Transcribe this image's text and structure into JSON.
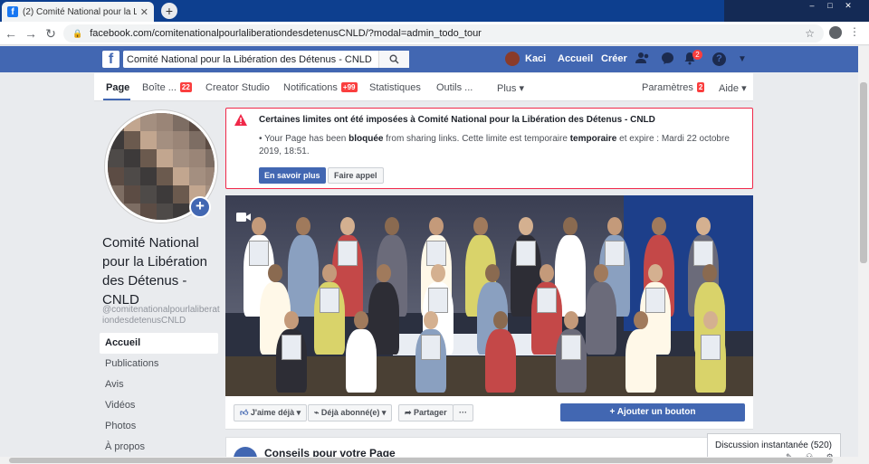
{
  "browser": {
    "tab_title": "(2) Comité National pour la Libéra",
    "tab_close": "✕",
    "new_tab": "+",
    "url": "facebook.com/comitenationalpourlaliberationdesdetenusCNLD/?modal=admin_todo_tour"
  },
  "fb_header": {
    "logo": "f",
    "search_value": "Comité National pour la Libération des Détenus - CNLD",
    "user_name": "Kaci",
    "home_label": "Accueil",
    "create_label": "Créer",
    "notifications_count": "2"
  },
  "page_tabs": [
    {
      "label": "Page",
      "badge": ""
    },
    {
      "label": "Boîte ...",
      "badge": "22"
    },
    {
      "label": "Creator Studio",
      "badge": ""
    },
    {
      "label": "Notifications",
      "badge": "+99"
    },
    {
      "label": "Statistiques",
      "badge": ""
    },
    {
      "label": "Outils ...",
      "badge": ""
    },
    {
      "label": "Plus ▾",
      "badge": ""
    },
    {
      "label": "Paramètres",
      "badge": "2"
    },
    {
      "label": "Aide ▾",
      "badge": ""
    }
  ],
  "page": {
    "name": "Comité National pour la Libération des Détenus - CNLD",
    "handle": "@comitenationalpourlaliberationdesdetenusCNLD"
  },
  "left_nav": [
    "Accueil",
    "Publications",
    "Avis",
    "Vidéos",
    "Photos",
    "À propos"
  ],
  "alert": {
    "title": "Certaines limites ont été imposées à Comité National pour la Libération des Détenus - CNLD",
    "body_1": "Your Page has been ",
    "body_bold_1": "bloquée",
    "body_2": " from sharing links. Cette limite est temporaire ",
    "body_bold_2": "temporaire",
    "body_3": " et expire : Mardi 22 octobre 2019, 18:51.",
    "learn_more": "En savoir plus",
    "appeal": "Faire appel"
  },
  "actions": {
    "like": "J'aime déjà ▾",
    "follow": "Déjà abonné(e) ▾",
    "share": "Partager",
    "more": "···",
    "add_button": "+ Ajouter un bouton"
  },
  "tips_title": "Conseils pour votre Page",
  "chat_label": "Discussion instantanée (520)",
  "colors": {
    "fb_blue": "#4267b2",
    "alert_red": "#f02849",
    "badge_red": "#fa3e3e"
  }
}
